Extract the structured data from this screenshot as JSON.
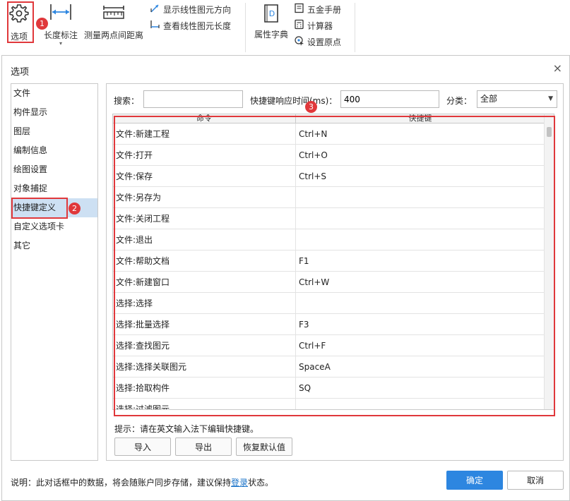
{
  "ribbon": {
    "options_label": "选项",
    "length_dim_label": "长度标注",
    "measure_label": "测量两点间距离",
    "show_dir_label": "显示线性图元方向",
    "view_len_label": "查看线性图元长度",
    "attr_dict_label": "属性字典",
    "hardware_label": "五金手册",
    "calculator_label": "计算器",
    "set_origin_label": "设置原点",
    "dict_icon_letter": "D"
  },
  "badges": [
    "1",
    "2",
    "3"
  ],
  "dialog": {
    "title": "选项",
    "close": "×",
    "nav": [
      "文件",
      "构件显示",
      "图层",
      "编制信息",
      "绘图设置",
      "对象捕捉",
      "快捷键定义",
      "自定义选项卡",
      "其它"
    ],
    "search_label": "搜索：",
    "search_value": "",
    "response_label": "快捷键响应时间(ms)：",
    "response_value": "400",
    "category_label": "分类：",
    "category_value": "全部",
    "table": {
      "headers": [
        "命令",
        "快捷键"
      ],
      "rows": [
        [
          "文件:新建工程",
          "Ctrl+N"
        ],
        [
          "文件:打开",
          "Ctrl+O"
        ],
        [
          "文件:保存",
          "Ctrl+S"
        ],
        [
          "文件:另存为",
          ""
        ],
        [
          "文件:关闭工程",
          ""
        ],
        [
          "文件:退出",
          ""
        ],
        [
          "文件:帮助文档",
          "F1"
        ],
        [
          "文件:新建窗口",
          "Ctrl+W"
        ],
        [
          "选择:选择",
          ""
        ],
        [
          "选择:批量选择",
          "F3"
        ],
        [
          "选择:查找图元",
          "Ctrl+F"
        ],
        [
          "选择:选择关联图元",
          "SpaceA"
        ],
        [
          "选择:拾取构件",
          "SQ"
        ],
        [
          "选择:过滤图元",
          ""
        ]
      ]
    },
    "hint": "提示：请在英文输入法下编辑快捷键。",
    "import_label": "导入",
    "export_label": "导出",
    "restore_label": "恢复默认值",
    "footnote_pre": "说明：此对话框中的数据，将会随账户同步存储，建议保持",
    "footnote_link": "登录",
    "footnote_post": "状态。",
    "ok_label": "确定",
    "cancel_label": "取消"
  },
  "colors": {
    "accent": "#2d86e0",
    "highlight": "#e0383b",
    "selection": "#cde0f3"
  }
}
